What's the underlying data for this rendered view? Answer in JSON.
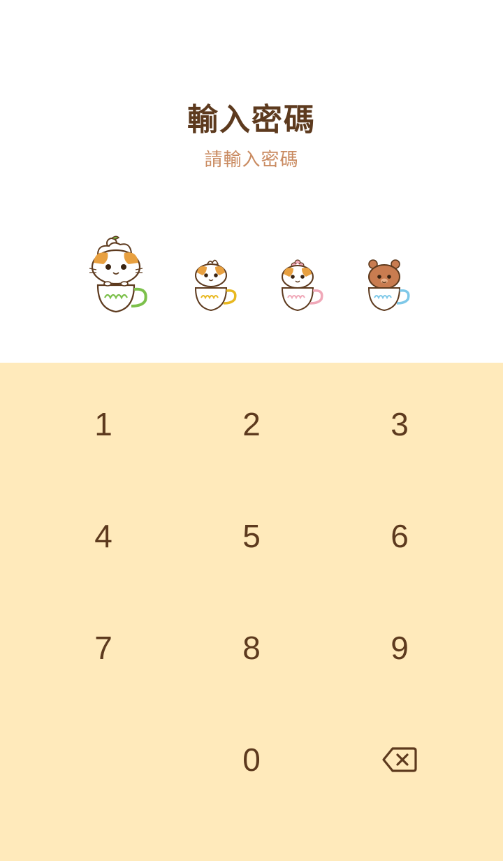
{
  "header": {
    "title": "輸入密碼",
    "subtitle": "請輸入密碼"
  },
  "passcode": {
    "length": 4,
    "entered": 1,
    "indicators": [
      {
        "state": "active",
        "topping": "apple",
        "cup_accent": "#7cc04b"
      },
      {
        "state": "empty",
        "topping": "cream",
        "cup_accent": "#e8b820"
      },
      {
        "state": "empty",
        "topping": "flower",
        "cup_accent": "#f0a8b8"
      },
      {
        "state": "empty",
        "topping": "none",
        "cup_accent": "#7ec8e8"
      }
    ]
  },
  "keypad": {
    "keys": [
      "1",
      "2",
      "3",
      "4",
      "5",
      "6",
      "7",
      "8",
      "9",
      "",
      "0",
      "backspace"
    ],
    "backspace_icon": "backspace-icon"
  },
  "colors": {
    "text": "#5d3a1e",
    "subtitle": "#c98a60",
    "keypad_bg": "#ffeabb",
    "top_bg": "#ffffff"
  }
}
